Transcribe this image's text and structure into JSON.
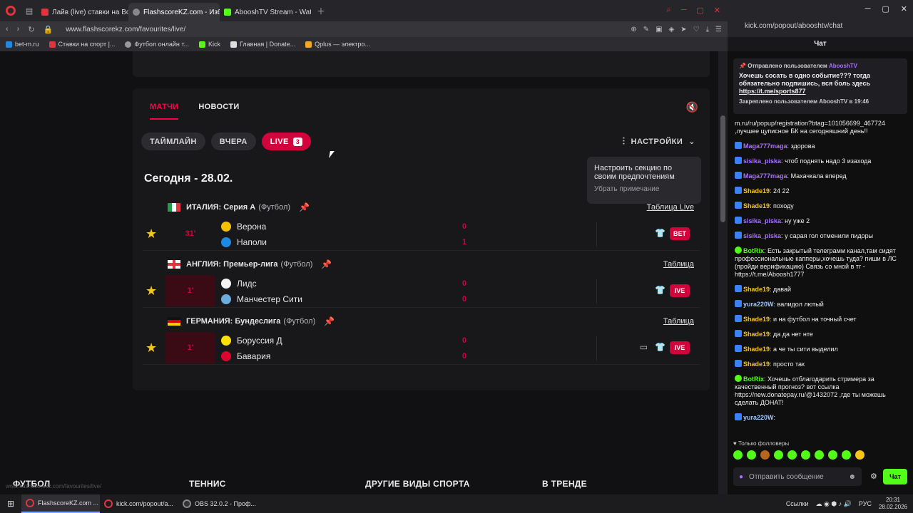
{
  "browser": {
    "tabs": [
      {
        "label": "Лайв (live) ставки на Вол",
        "color": "#e0353c"
      },
      {
        "label": "FlashscoreKZ.com - Избр",
        "color": "#888888"
      },
      {
        "label": "AbooshTV Stream - Watch",
        "color": "#53fc18"
      }
    ],
    "url": "www.flashscorekz.com/favourites/live/",
    "bookmarks": [
      "bet-m.ru",
      "Ставки на спорт |...",
      "Футбол онлайн т...",
      "Kick",
      "Главная | Donate...",
      "Qplus — электро..."
    ]
  },
  "page": {
    "main_tabs": [
      "МАТЧИ",
      "НОВОСТИ"
    ],
    "filters": [
      "ТАЙМЛАЙН",
      "ВЧЕРА",
      "LIVE"
    ],
    "live_count": "3",
    "settings_label": "НАСТРОЙКИ",
    "tooltip_text": "Настроить секцию по своим предпочтениям",
    "tooltip_dismiss": "Убрать примечание",
    "date": "Сегодня - 28.02.",
    "leagues": [
      {
        "name": "ИТАЛИЯ: Серия А",
        "sport": "(Футбол)",
        "link": "Таблица Live"
      },
      {
        "name": "АНГЛИЯ: Премьер-лига",
        "sport": "(Футбол)",
        "link": "Таблица"
      },
      {
        "name": "ГЕРМАНИЯ: Бундеслига",
        "sport": "(Футбол)",
        "link": "Таблица"
      }
    ],
    "matches": [
      {
        "minute": "31'",
        "home": "Верона",
        "away": "Наполи",
        "home_score": "0",
        "away_score": "1",
        "action": "BET"
      },
      {
        "minute": "1'",
        "home": "Лидс",
        "away": "Манчестер Сити",
        "home_score": "0",
        "away_score": "0",
        "action": "IVE"
      },
      {
        "minute": "1'",
        "home": "Боруссия Д",
        "away": "Бавария",
        "home_score": "0",
        "away_score": "0",
        "action": "IVE"
      }
    ],
    "footer": [
      "ФУТБОЛ",
      "ТЕННИС",
      "ДРУГИЕ ВИДЫ СПОРТА",
      "В ТРЕНДЕ"
    ],
    "status_url": "www.flashscorekz.com/favourites/live/"
  },
  "chat": {
    "url": "kick.com/popout/abooshtv/chat",
    "title": "Чат",
    "pinned_by": "Отправлено пользователем",
    "pinned_user": "AbooshTV",
    "pinned_message": "Хочешь сосать в одно событие??? тогда обязательно подпишись, вся боль здесь",
    "pinned_link": "https://t.me/sports877",
    "pinned_footer": "Закреплено пользователем AbooshTV в 19:46",
    "messages": [
      {
        "user": "",
        "text": "m.ru/ru/popup/registration?btag=101056699_467724 ,лучшее цуписное БК на сегодняшний день!!",
        "color": "#efefef"
      },
      {
        "user": "Maga777maga",
        "text": "здорова",
        "color": "#a970ff"
      },
      {
        "user": "sisika_piska",
        "text": "чтоб поднять надо 3 изахода",
        "color": "#a970ff"
      },
      {
        "user": "Maga777maga",
        "text": "Махачкала вперед",
        "color": "#a970ff"
      },
      {
        "user": "Shade19",
        "text": "24 22",
        "color": "#f5c518"
      },
      {
        "user": "Shade19",
        "text": "походу",
        "color": "#f5c518"
      },
      {
        "user": "sisika_piska",
        "text": "ну уже 2",
        "color": "#a970ff"
      },
      {
        "user": "sisika_piska",
        "text": "у сарая гол отменили пидоры",
        "color": "#a970ff"
      },
      {
        "user": "BotRix",
        "text": "Есть закрытый телеграмм канал,там сидят профессиональные капперы,хочешь туда? пиши в ЛС (пройди верификацию) Связь со мной в тг - https://t.me/Aboosh1777",
        "color": "#53fc18"
      },
      {
        "user": "Shade19",
        "text": "давай",
        "color": "#f5c518"
      },
      {
        "user": "yura220W",
        "text": "валидол лютый",
        "color": "#a0c4ff"
      },
      {
        "user": "Shade19",
        "text": "и на футбол на точный счет",
        "color": "#f5c518"
      },
      {
        "user": "Shade19",
        "text": "да да нет нте",
        "color": "#f5c518"
      },
      {
        "user": "Shade19",
        "text": "а че ты сити выделил",
        "color": "#f5c518"
      },
      {
        "user": "Shade19",
        "text": "просто так",
        "color": "#f5c518"
      },
      {
        "user": "BotRix",
        "text": "Хочешь отблагодарить стримера за качественный прогноз? вот ссылка https://new.donatepay.ru/@1432072 ,где ты можешь сделать ДОНАТ!",
        "color": "#53fc18"
      },
      {
        "user": "yura220W",
        "text": "",
        "color": "#a0c4ff"
      }
    ],
    "followers_only": "Только фолловеры",
    "input_placeholder": "Отправить сообщение",
    "send_label": "Чат"
  },
  "taskbar": {
    "items": [
      "FlashscoreKZ.com ...",
      "kick.com/popout/a...",
      "OBS 32.0.2 - Проф..."
    ],
    "tray_label": "Ссылки",
    "lang": "РУС",
    "time": "20:31",
    "date": "28.02.2026"
  }
}
